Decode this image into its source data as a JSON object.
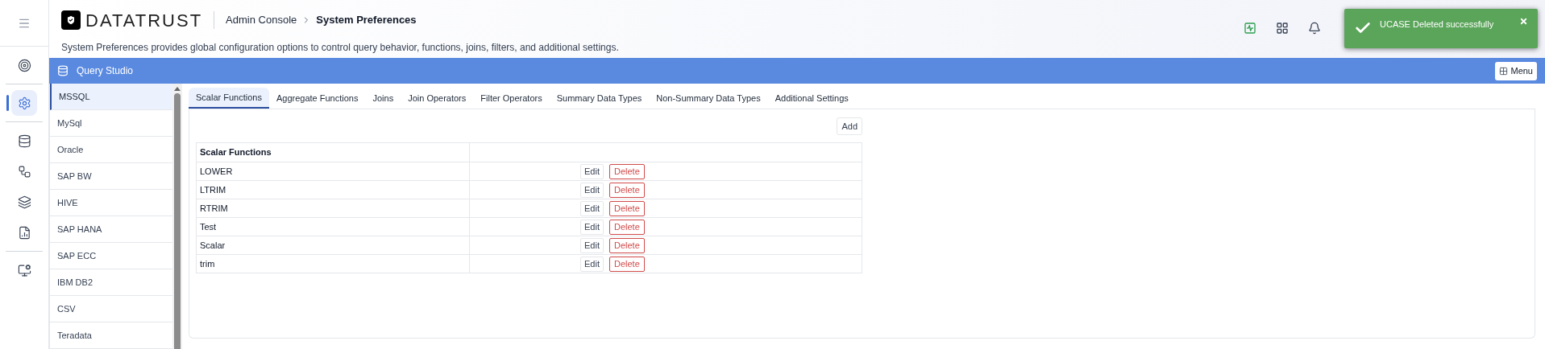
{
  "header": {
    "logo": "DATATRUST",
    "breadcrumb": [
      "Admin Console",
      "System Preferences"
    ],
    "description": "System Preferences provides global configuration options to control query behavior, functions, joins, filters, and additional settings."
  },
  "rail_groups": [
    [
      {
        "kind": "target",
        "selected": false
      }
    ],
    [
      {
        "kind": "settings",
        "selected": true
      }
    ],
    [
      {
        "kind": "database",
        "selected": false
      },
      {
        "kind": "nodes",
        "selected": false
      },
      {
        "kind": "layers",
        "selected": false
      },
      {
        "kind": "report",
        "selected": false
      }
    ],
    [
      {
        "kind": "monitor",
        "selected": false
      }
    ]
  ],
  "toast": {
    "message": "UCASE Deleted successfully"
  },
  "panel": {
    "title": "Query Studio",
    "menu_button": "Menu"
  },
  "sources": [
    {
      "label": "MSSQL",
      "selected": true
    },
    {
      "label": "MySql",
      "selected": false
    },
    {
      "label": "Oracle",
      "selected": false
    },
    {
      "label": "SAP BW",
      "selected": false
    },
    {
      "label": "HIVE",
      "selected": false
    },
    {
      "label": "SAP HANA",
      "selected": false
    },
    {
      "label": "SAP ECC",
      "selected": false
    },
    {
      "label": "IBM DB2",
      "selected": false
    },
    {
      "label": "CSV",
      "selected": false
    },
    {
      "label": "Teradata",
      "selected": false
    }
  ],
  "tabs": [
    {
      "label": "Scalar Functions",
      "selected": true
    },
    {
      "label": "Aggregate Functions",
      "selected": false
    },
    {
      "label": "Joins",
      "selected": false
    },
    {
      "label": "Join Operators",
      "selected": false
    },
    {
      "label": "Filter Operators",
      "selected": false
    },
    {
      "label": "Summary Data Types",
      "selected": false
    },
    {
      "label": "Non-Summary Data Types",
      "selected": false
    },
    {
      "label": "Additional Settings",
      "selected": false
    }
  ],
  "add_button": "Add",
  "table": {
    "columns": [
      "Scalar Functions"
    ],
    "rows": [
      {
        "name": "LOWER",
        "edit": "Edit",
        "delete": "Delete"
      },
      {
        "name": "LTRIM",
        "edit": "Edit",
        "delete": "Delete"
      },
      {
        "name": "RTRIM",
        "edit": "Edit",
        "delete": "Delete"
      },
      {
        "name": "Test",
        "edit": "Edit",
        "delete": "Delete"
      },
      {
        "name": "Scalar",
        "edit": "Edit",
        "delete": "Delete"
      },
      {
        "name": "trim",
        "edit": "Edit",
        "delete": "Delete"
      }
    ]
  }
}
